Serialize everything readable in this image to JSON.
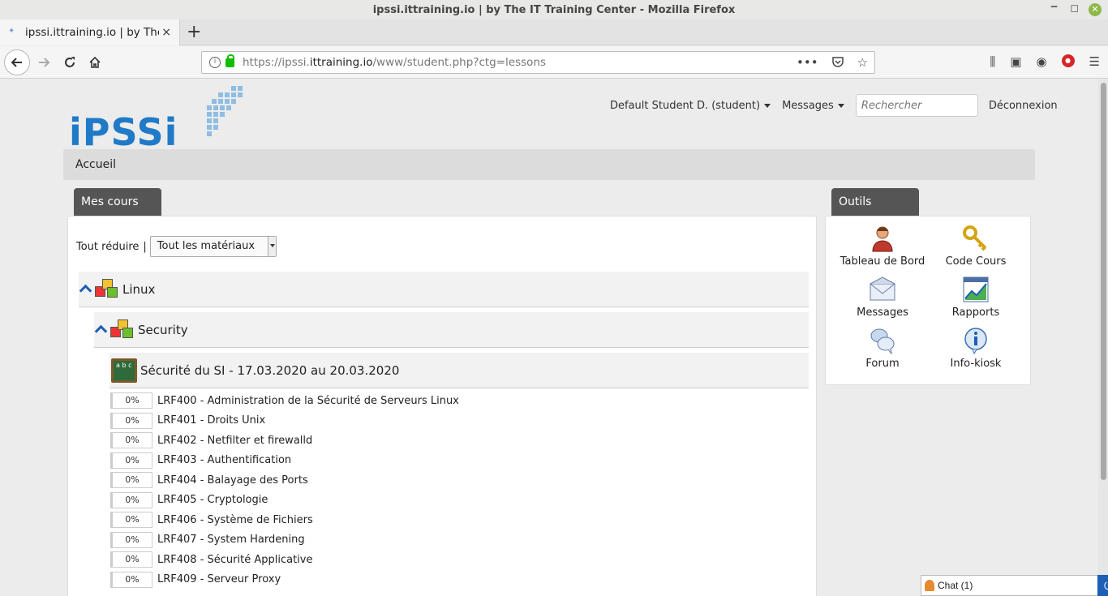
{
  "window": {
    "title": "ipssi.ittraining.io | by The IT Training Center - Mozilla Firefox"
  },
  "tab": {
    "title": "ipssi.ittraining.io | by The IT",
    "close": "×",
    "new_tab": "+"
  },
  "url": {
    "prefix": "https://ipssi.",
    "domain": "ittraining.io",
    "path": "/www/student.php?ctg=lessons"
  },
  "logo": {
    "text": "iPSSi"
  },
  "topnav": {
    "user": "Default Student D. (student)",
    "messages": "Messages",
    "search_placeholder": "Rechercher",
    "logout": "Déconnexion"
  },
  "breadcrumb": "Accueil",
  "courses_panel": {
    "title": "Mes cours",
    "collapse_all": "Tout réduire",
    "separator": "|",
    "filter_value": "Tout les matériaux",
    "categories": [
      {
        "name": "Linux"
      },
      {
        "name": "Security"
      }
    ],
    "session": {
      "title": "Sécurité du SI - 17.03.2020 au 20.03.2020",
      "board_text": "a b c"
    },
    "lessons": [
      {
        "progress": "0%",
        "title": "LRF400 - Administration de la Sécurité de Serveurs Linux"
      },
      {
        "progress": "0%",
        "title": "LRF401 - Droits Unix"
      },
      {
        "progress": "0%",
        "title": "LRF402 - Netfilter et firewalld"
      },
      {
        "progress": "0%",
        "title": "LRF403 - Authentification"
      },
      {
        "progress": "0%",
        "title": "LRF404 - Balayage des Ports"
      },
      {
        "progress": "0%",
        "title": "LRF405 - Cryptologie"
      },
      {
        "progress": "0%",
        "title": "LRF406 - Système de Fichiers"
      },
      {
        "progress": "0%",
        "title": "LRF407 - System Hardening"
      },
      {
        "progress": "0%",
        "title": "LRF408 - Sécurité Applicative"
      },
      {
        "progress": "0%",
        "title": "LRF409 - Serveur Proxy"
      }
    ]
  },
  "tools_panel": {
    "title": "Outils",
    "items": [
      {
        "label": "Tableau de Bord",
        "icon": "user-icon"
      },
      {
        "label": "Code Cours",
        "icon": "key-icon"
      },
      {
        "label": "Messages",
        "icon": "envelope-icon"
      },
      {
        "label": "Rapports",
        "icon": "chart-icon"
      },
      {
        "label": "Forum",
        "icon": "speech-bubbles-icon"
      },
      {
        "label": "Info-kiosk",
        "icon": "info-icon"
      }
    ]
  },
  "chat": {
    "label": "Chat (1)"
  },
  "colors": {
    "brand": "#1f7ac7",
    "panel_tab": "#555555",
    "accent_blue": "#1c5fb5"
  }
}
